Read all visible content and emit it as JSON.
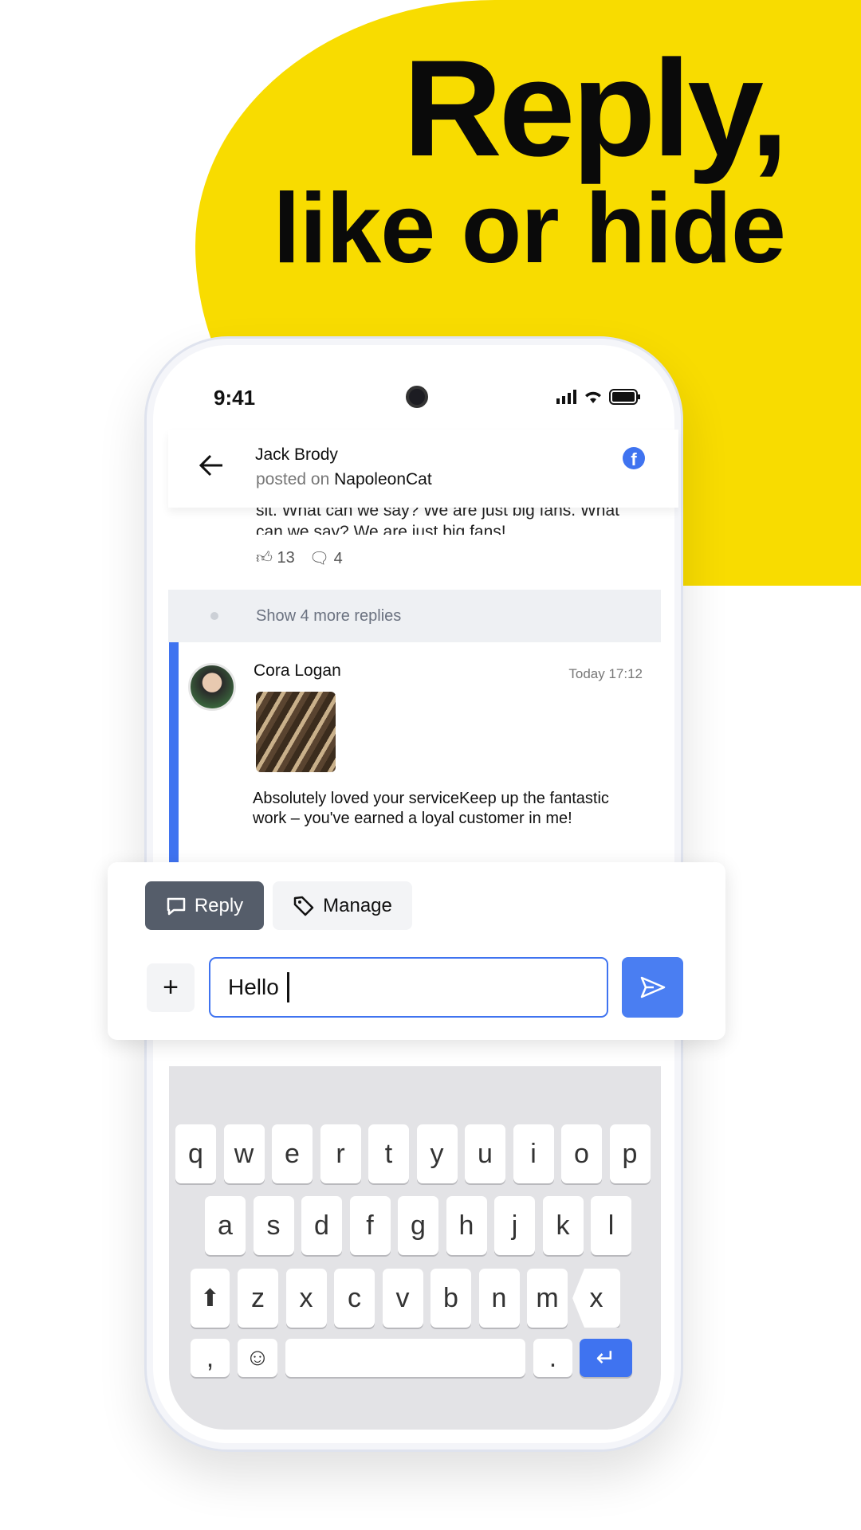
{
  "headline": {
    "line1": "Reply,",
    "line2": "like or hide"
  },
  "status": {
    "time": "9:41"
  },
  "header": {
    "author": "Jack Brody",
    "posted_on_prefix": "posted on",
    "page": "NapoleonCat",
    "network_icon": "facebook-icon"
  },
  "prev_comment": {
    "text_cut": "sit. What can we say? We are just big fans. What",
    "text_last": "can we say? We are just big fans!",
    "likes": "13",
    "replies": "4"
  },
  "show_more": "Show 4 more replies",
  "comment": {
    "author": "Cora Logan",
    "time": "Today 17:12",
    "text": "Absolutely loved your serviceKeep up the fantastic work – you've earned a loyal customer in me!"
  },
  "actions": {
    "reply": "Reply",
    "manage": "Manage",
    "plus": "+",
    "input_value": "Hello"
  },
  "keyboard": {
    "row1": [
      "q",
      "w",
      "e",
      "r",
      "t",
      "y",
      "u",
      "i",
      "o",
      "p"
    ],
    "row2": [
      "a",
      "s",
      "d",
      "f",
      "g",
      "h",
      "j",
      "k",
      "l"
    ],
    "row3": [
      "z",
      "x",
      "c",
      "v",
      "b",
      "n",
      "m"
    ],
    "comma": ",",
    "period": "."
  },
  "colors": {
    "accent": "#3f73f0",
    "yellow": "#f8dc00",
    "reply_bg": "#555d6a"
  }
}
